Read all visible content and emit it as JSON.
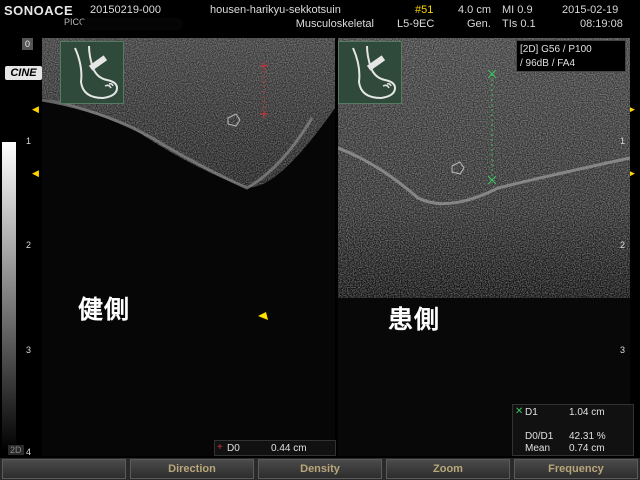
{
  "header": {
    "brand": "SONOACE",
    "model": "PICO",
    "patient_id": "20150219-000",
    "hospital": "housen-harikyu-sekkotsuin",
    "preset": "Musculoskeletal",
    "frame": "#51",
    "probe": "L5-9EC",
    "depth": "4.0 cm",
    "gen": "Gen.",
    "mi": "MI  0.9",
    "tis": "TIs  0.1",
    "date": "2015-02-19",
    "time": "08:19:08"
  },
  "left_panel": {
    "zero_badge": "0",
    "cine": "CINE",
    "depth_marks": [
      "1",
      "2",
      "3",
      "4"
    ],
    "mode_tag": "2D"
  },
  "image_params": {
    "line1": "[2D] G56 / P100",
    "line2": "/ 96dB / FA4"
  },
  "labels": {
    "left_kanji": "健側",
    "right_kanji": "患側"
  },
  "measurements": {
    "d0": {
      "label": "D0",
      "value": "0.44 cm"
    },
    "d1": {
      "label": "D1",
      "value": "1.04 cm"
    },
    "ratio": {
      "label": "D0/D1",
      "value": "42.31 %"
    },
    "mean": {
      "label": "Mean",
      "value": "0.74 cm"
    }
  },
  "bottom_bar": [
    "",
    "Direction",
    "Density",
    "Zoom",
    "Frequency"
  ],
  "colors": {
    "accent": "#ffd400",
    "caliper_red": "#d0323a",
    "caliper_green": "#3ac860",
    "button_text": "#b9a77a"
  }
}
